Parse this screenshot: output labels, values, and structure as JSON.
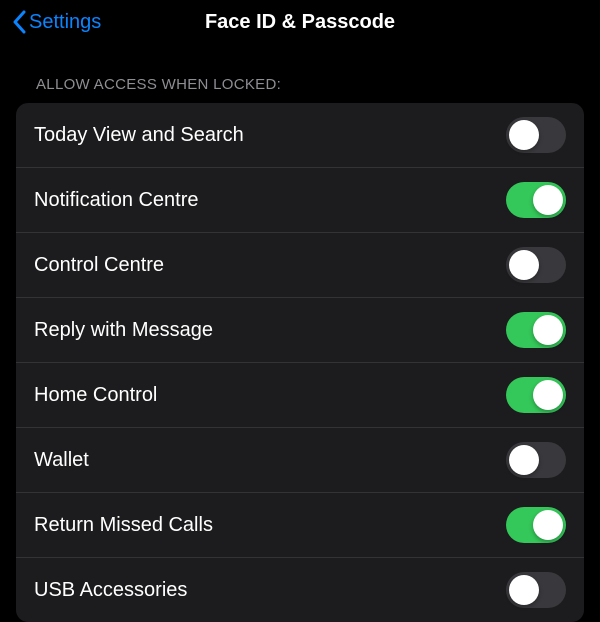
{
  "nav": {
    "back_label": "Settings",
    "title": "Face ID & Passcode"
  },
  "section": {
    "header": "ALLOW ACCESS WHEN LOCKED:"
  },
  "rows": [
    {
      "label": "Today View and Search",
      "on": false
    },
    {
      "label": "Notification Centre",
      "on": true
    },
    {
      "label": "Control Centre",
      "on": false
    },
    {
      "label": "Reply with Message",
      "on": true
    },
    {
      "label": "Home Control",
      "on": true
    },
    {
      "label": "Wallet",
      "on": false
    },
    {
      "label": "Return Missed Calls",
      "on": true
    },
    {
      "label": "USB Accessories",
      "on": false
    }
  ]
}
